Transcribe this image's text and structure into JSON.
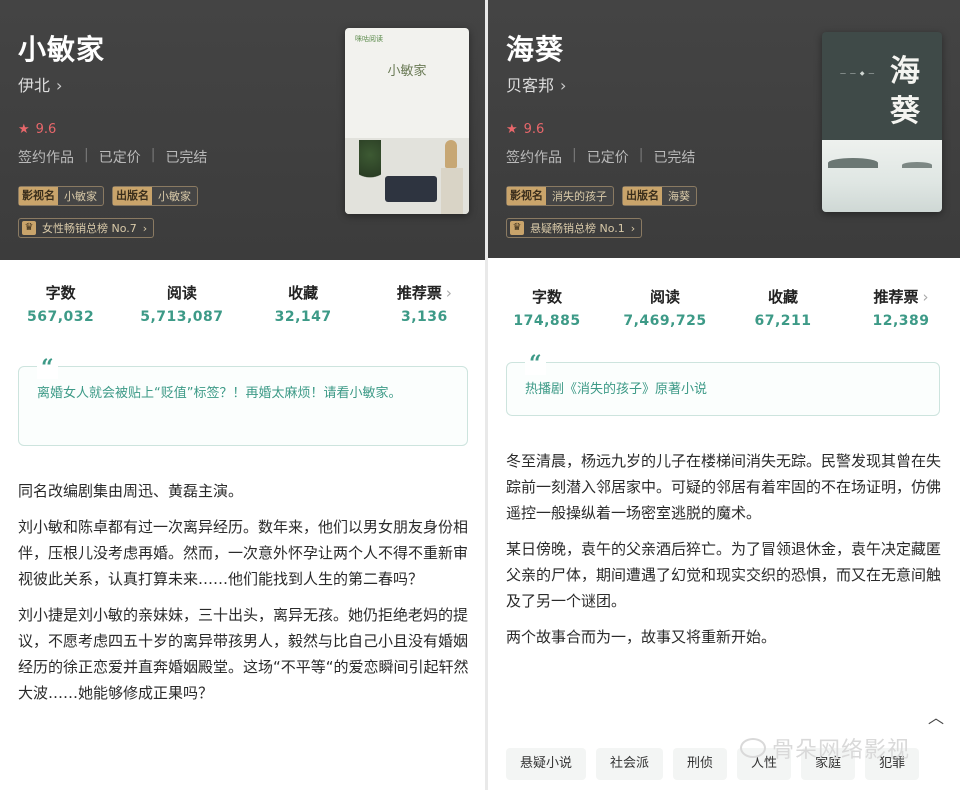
{
  "left": {
    "title": "小敏家",
    "author": "伊北",
    "rating": "9.6",
    "meta": [
      "签约作品",
      "已定价",
      "已完结"
    ],
    "tags": [
      {
        "badge": "影视名",
        "text": "小敏家"
      },
      {
        "badge": "出版名",
        "text": "小敏家"
      }
    ],
    "rank": "女性畅销总榜 No.7",
    "cover": {
      "brand": "咪咕阅读",
      "title": "小敏家"
    },
    "stats": [
      {
        "label": "字数",
        "value": "567,032"
      },
      {
        "label": "阅读",
        "value": "5,713,087"
      },
      {
        "label": "收藏",
        "value": "32,147"
      },
      {
        "label": "推荐票",
        "value": "3,136"
      }
    ],
    "quote": "离婚女人就会被贴上“贬值”标签？！再婚太麻烦！请看小敏家。",
    "paragraphs": [
      "同名改编剧集由周迅、黄磊主演。",
      "刘小敏和陈卓都有过一次离异经历。数年来，他们以男女朋友身份相伴，压根儿没考虑再婚。然而，一次意外怀孕让两个人不得不重新审视彼此关系，认真打算未来……他们能找到人生的第二春吗？",
      "刘小捷是刘小敏的亲妹妹，三十出头，离异无孩。她仍拒绝老妈的提议，不愿考虑四五十岁的离异带孩男人，毅然与比自己小且没有婚姻经历的徐正恋爱并直奔婚姻殿堂。这场“不平等“的爱恋瞬间引起轩然大波……她能够修成正果吗？"
    ]
  },
  "right": {
    "title": "海葵",
    "author": "贝客邦",
    "rating": "9.6",
    "meta": [
      "签约作品",
      "已定价",
      "已完结"
    ],
    "tags": [
      {
        "badge": "影视名",
        "text": "消失的孩子"
      },
      {
        "badge": "出版名",
        "text": "海葵"
      }
    ],
    "rank": "悬疑畅销总榜 No.1",
    "cover": {
      "t1": "海",
      "t2": "葵"
    },
    "stats": [
      {
        "label": "字数",
        "value": "174,885"
      },
      {
        "label": "阅读",
        "value": "7,469,725"
      },
      {
        "label": "收藏",
        "value": "67,211"
      },
      {
        "label": "推荐票",
        "value": "12,389"
      }
    ],
    "quote": "热播剧《消失的孩子》原著小说",
    "paragraphs": [
      "冬至清晨，杨远九岁的儿子在楼梯间消失无踪。民警发现其曾在失踪前一刻潜入邻居家中。可疑的邻居有着牢固的不在场证明，仿佛遥控一般操纵着一场密室逃脱的魔术。",
      "某日傍晚，袁午的父亲酒后猝亡。为了冒领退休金，袁午决定藏匿父亲的尸体，期间遭遇了幻觉和现实交织的恐惧，而又在无意间触及了另一个谜团。",
      "两个故事合而为一，故事又将重新开始。"
    ],
    "chips": [
      "悬疑小说",
      "社会派",
      "刑侦",
      "人性",
      "家庭",
      "犯罪"
    ]
  },
  "watermark": "骨朵网络影视",
  "colors": {
    "accent": "#3d9a87",
    "rating": "#e8676b",
    "hero_bg": "#404040"
  }
}
